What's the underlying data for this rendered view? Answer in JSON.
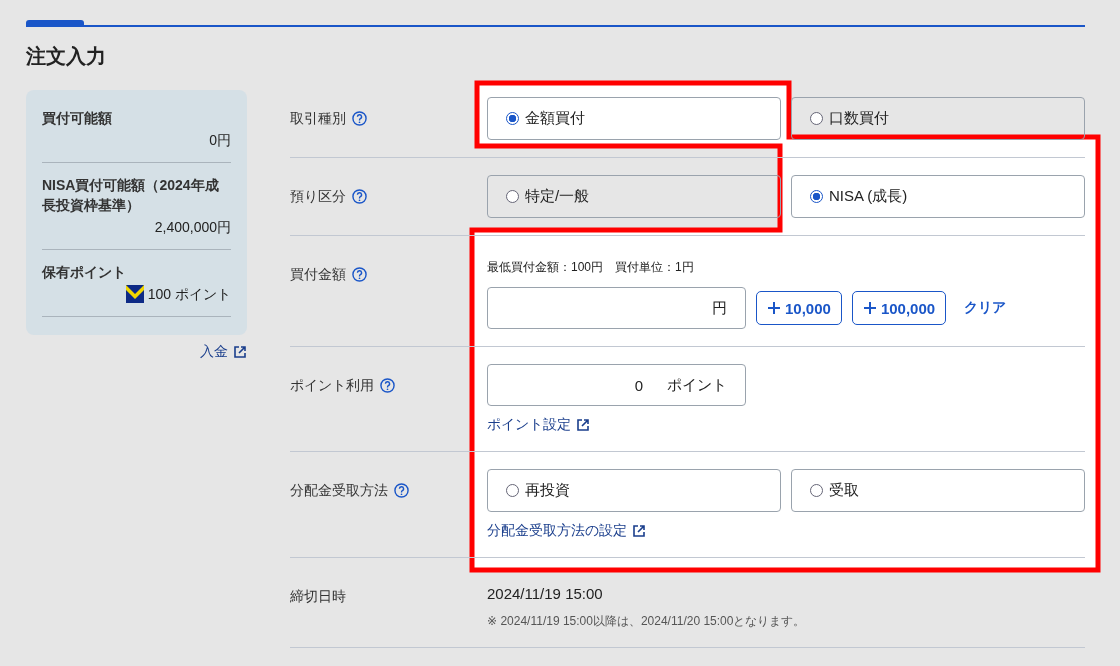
{
  "title": "注文入力",
  "side_panel": {
    "items": [
      {
        "kind": "amount",
        "label": "買付可能額",
        "value": "0円"
      },
      {
        "kind": "amount",
        "label": "NISA買付可能額（2024年成長投資枠基準）",
        "value": "2,400,000円"
      },
      {
        "kind": "points",
        "label": "保有ポイント",
        "value": "100 ポイント"
      }
    ],
    "link": "入金"
  },
  "rows": [
    {
      "kind": "radio",
      "label": "取引種別",
      "help": true,
      "options": [
        {
          "label": "金額買付",
          "selected": true
        },
        {
          "label": "口数買付",
          "selected": false
        }
      ]
    },
    {
      "kind": "radio",
      "label": "預り区分",
      "help": true,
      "options": [
        {
          "label": "特定/一般",
          "selected": false
        },
        {
          "label": "NISA (成長)",
          "selected": true
        }
      ]
    },
    {
      "kind": "amount",
      "label": "買付金額",
      "help": true,
      "hint": "最低買付金額：100円　買付単位：1円",
      "unit": "円",
      "buttons": [
        "10,000",
        "100,000"
      ],
      "clear": "クリア"
    },
    {
      "kind": "points",
      "label": "ポイント利用",
      "help": true,
      "value": "0",
      "unit": "ポイント",
      "link": "ポイント設定"
    },
    {
      "kind": "radio",
      "label": "分配金受取方法",
      "help": true,
      "options": [
        {
          "label": "再投資",
          "selected": false
        },
        {
          "label": "受取",
          "selected": false
        }
      ],
      "link": "分配金受取方法の設定"
    },
    {
      "kind": "text",
      "label": "締切日時",
      "help": false,
      "value": "2024/11/19 15:00",
      "note": "※ 2024/11/19 15:00以降は、2024/11/20 15:00となります。"
    }
  ]
}
